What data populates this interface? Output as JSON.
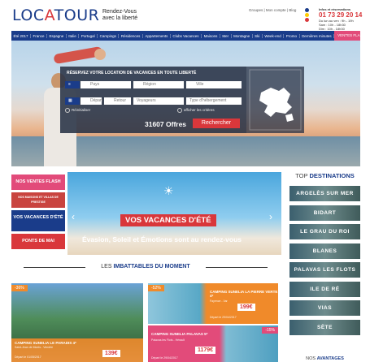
{
  "header": {
    "logo_prefix": "LOC",
    "logo_a": "A",
    "logo_suffix": "TOUR",
    "tagline_1": "Rendez-Vous",
    "tagline_2": "avec la liberté",
    "toplinks": "Groupes | Mon compte | Blog",
    "info_title": "Infos et réservations",
    "phone": "01 73 29 20 14",
    "hours_1": "Du lun au ven : 9h - 19h",
    "hours_2": "Sam : 10h - 18h30",
    "hours_3": "Dim : 10h - 18h30",
    "flag_colors": [
      "#1a3c8a",
      "#ffcc00",
      "#d9373b"
    ]
  },
  "nav": {
    "items": [
      "Été 2017",
      "France",
      "Espagne",
      "Italie",
      "Portugal",
      "Campings",
      "Résidences",
      "Appartements",
      "Clubs Vacances",
      "Maisons",
      "Mer",
      "Montagne",
      "Ski",
      "Week-end",
      "Promo",
      "Dernières minutes"
    ],
    "flash": "VENTES FLASH"
  },
  "search": {
    "title": "RÉSERVEZ VOTRE LOCATION DE VACANCES EN TOUTE LIBERTÉ",
    "pays": "Pays",
    "region": "Région",
    "ville": "Ville",
    "depart": "Départ",
    "retour": "Retour",
    "voyageurs": "Voyageurs",
    "hebergement": "Type d'hébergement",
    "reinitialiser": "Réinitialiser",
    "afficher": "afficher les critères",
    "offers": "31607 Offres",
    "button": "Rechercher"
  },
  "tiles": [
    {
      "label": "NOS VENTES FLASH",
      "color": "#e24b7a"
    },
    {
      "label": "NOS MAISONS ET VILLAS DE PRESTIGE",
      "color": "#c9443f"
    },
    {
      "label": "VOS VACANCES D'ÉTÉ",
      "color": "#1a3c8a"
    },
    {
      "label": "PONTS DE MAI",
      "color": "#d9373b"
    }
  ],
  "slider": {
    "title": "VOS VACANCES D'ÉTÉ",
    "subtitle": "Évasion, Soleil et Émotions sont au rendez-vous",
    "prev": "‹",
    "next": "›"
  },
  "destinations": {
    "title_pre": "TOP",
    "title_bold": "DESTINATIONS",
    "items": [
      "ARGELÈS SUR MER",
      "BIDART",
      "LE GRAU DU ROI",
      "BLANES",
      "PALAVAS LES FLOTS",
      "ILE DE RÉ",
      "VIAS",
      "SÈTE"
    ]
  },
  "imbattables": {
    "title_pre": "LES",
    "title_bold": "IMBATTABLES DU MOMENT"
  },
  "cards": [
    {
      "badge": "-36%",
      "name": "CAMPING SUNELIA LE PARADIS 4*",
      "desc": "Saint-Jean de Monts - Vendée",
      "price": "139€",
      "price_note": "Départ le 01/05/2017",
      "badge_color": "#f08a2a"
    },
    {
      "badge": "-52%",
      "name": "CAMPING SUNELIA LA PIERRE VERTE 4*",
      "desc": "Fayence - Var",
      "price": "199€",
      "price_note": "Départ le 29/04/2017",
      "badge_color": "#f08a2a"
    },
    {
      "badge": "-15%",
      "name": "CAMPING SUNELIA PALAVAS 5*",
      "desc": "Palavas les Flots - Hérault",
      "price": "1179€",
      "price_note": "Départ le 29/04/2017",
      "badge_color": "#e24b7a"
    }
  ],
  "avantages": {
    "pre": "NOS",
    "bold": "AVANTAGES"
  }
}
